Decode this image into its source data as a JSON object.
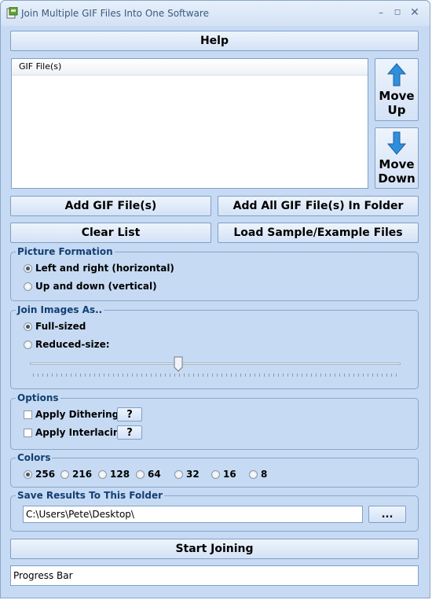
{
  "window": {
    "title": "Join Multiple GIF Files Into One Software"
  },
  "buttons": {
    "help": "Help",
    "move_up": [
      "Move",
      "Up"
    ],
    "move_down": [
      "Move",
      "Down"
    ],
    "add_files": "Add GIF File(s)",
    "add_folder": "Add All GIF File(s) In Folder",
    "clear_list": "Clear List",
    "load_sample": "Load Sample/Example Files",
    "start": "Start Joining",
    "browse": "...",
    "help_q": "?"
  },
  "file_list": {
    "column_header": "GIF File(s)",
    "items": []
  },
  "picture_formation": {
    "legend": "Picture Formation",
    "options": [
      "Left and right (horizontal)",
      "Up and down (vertical)"
    ],
    "selected": 0
  },
  "join_as": {
    "legend": "Join Images As..",
    "options": [
      "Full-sized",
      "Reduced-size:"
    ],
    "selected": 0,
    "slider_fraction": 0.4
  },
  "options": {
    "legend": "Options",
    "dithering": "Apply Dithering",
    "interlacing": "Apply Interlacing"
  },
  "colors": {
    "legend": "Colors",
    "options": [
      "256",
      "216",
      "128",
      "64",
      "32",
      "16",
      "8"
    ],
    "selected": 0
  },
  "save": {
    "legend": "Save Results To This Folder",
    "path": "C:\\Users\\Pete\\Desktop\\"
  },
  "progress": {
    "label": "Progress Bar"
  }
}
